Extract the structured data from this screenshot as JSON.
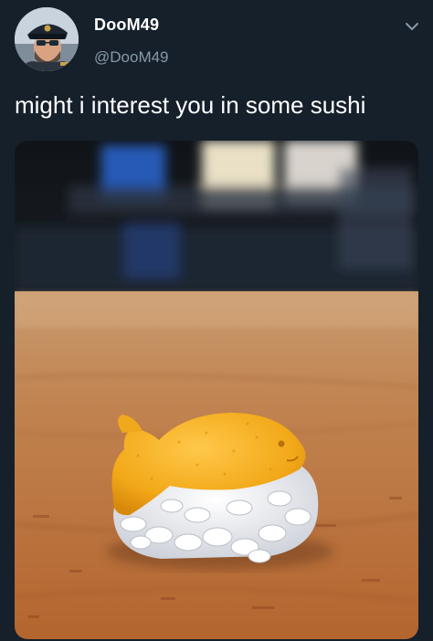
{
  "author": {
    "display_name": "DooM49",
    "handle": "@DooM49",
    "avatar_icon": "user-avatar"
  },
  "tweet": {
    "text": "might i interest you in some sushi"
  },
  "media": {
    "alt_icon": "photo-goldfish-cracker-nigiri"
  },
  "menu": {
    "icon": "chevron-down-icon"
  },
  "colors": {
    "background": "#15202b",
    "text_primary": "#ffffff",
    "text_secondary": "#8899a6"
  }
}
